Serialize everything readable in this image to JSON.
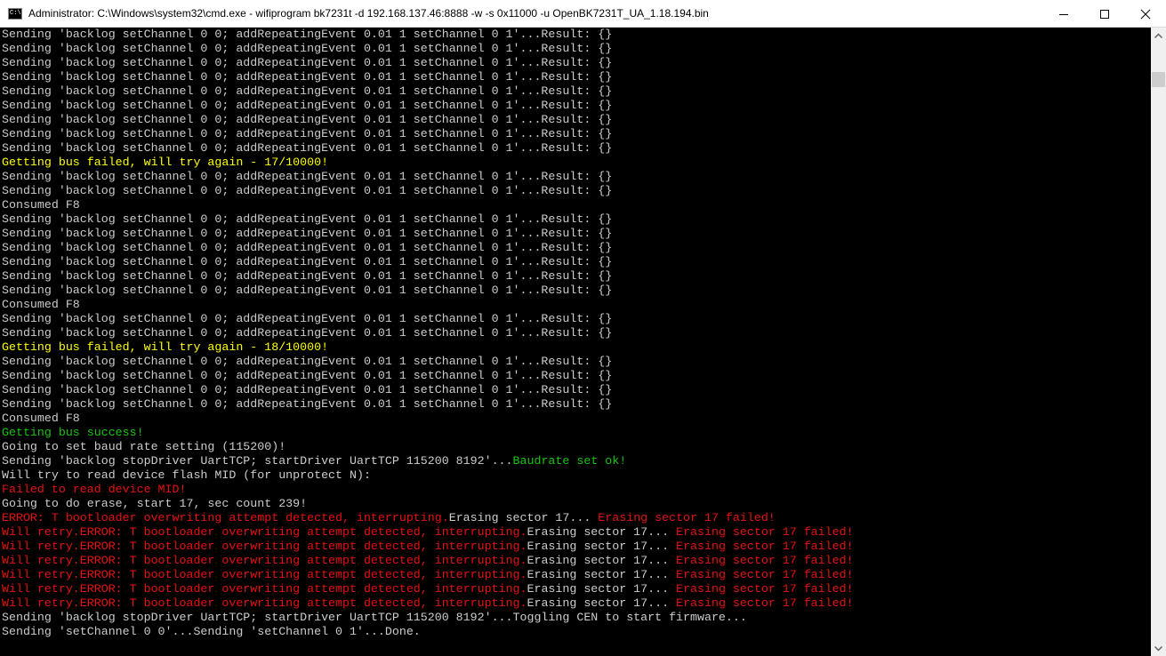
{
  "window": {
    "title": "Administrator: C:\\Windows\\system32\\cmd.exe - wifiprogram  bk7231t -d 192.168.137.46:8888 -w -s 0x11000 -u OpenBK7231T_UA_1.18.194.bin",
    "icon_text": "C:\\"
  },
  "colors": {
    "default": "#cccccc",
    "yellow": "#ffff00",
    "green": "#16c60c",
    "red": "#e81010"
  },
  "lines": [
    {
      "segs": [
        {
          "t": "Sending 'backlog setChannel 0 0; addRepeatingEvent 0.01 1 setChannel 0 1'...Result: {}",
          "c": "default"
        }
      ]
    },
    {
      "segs": [
        {
          "t": "Sending 'backlog setChannel 0 0; addRepeatingEvent 0.01 1 setChannel 0 1'...Result: {}",
          "c": "default"
        }
      ]
    },
    {
      "segs": [
        {
          "t": "Sending 'backlog setChannel 0 0; addRepeatingEvent 0.01 1 setChannel 0 1'...Result: {}",
          "c": "default"
        }
      ]
    },
    {
      "segs": [
        {
          "t": "Sending 'backlog setChannel 0 0; addRepeatingEvent 0.01 1 setChannel 0 1'...Result: {}",
          "c": "default"
        }
      ]
    },
    {
      "segs": [
        {
          "t": "Sending 'backlog setChannel 0 0; addRepeatingEvent 0.01 1 setChannel 0 1'...Result: {}",
          "c": "default"
        }
      ]
    },
    {
      "segs": [
        {
          "t": "Sending 'backlog setChannel 0 0; addRepeatingEvent 0.01 1 setChannel 0 1'...Result: {}",
          "c": "default"
        }
      ]
    },
    {
      "segs": [
        {
          "t": "Sending 'backlog setChannel 0 0; addRepeatingEvent 0.01 1 setChannel 0 1'...Result: {}",
          "c": "default"
        }
      ]
    },
    {
      "segs": [
        {
          "t": "Sending 'backlog setChannel 0 0; addRepeatingEvent 0.01 1 setChannel 0 1'...Result: {}",
          "c": "default"
        }
      ]
    },
    {
      "segs": [
        {
          "t": "Sending 'backlog setChannel 0 0; addRepeatingEvent 0.01 1 setChannel 0 1'...Result: {}",
          "c": "default"
        }
      ]
    },
    {
      "segs": [
        {
          "t": "Getting bus failed, will try again - 17/10000!",
          "c": "yellow"
        }
      ]
    },
    {
      "segs": [
        {
          "t": "Sending 'backlog setChannel 0 0; addRepeatingEvent 0.01 1 setChannel 0 1'...Result: {}",
          "c": "default"
        }
      ]
    },
    {
      "segs": [
        {
          "t": "Sending 'backlog setChannel 0 0; addRepeatingEvent 0.01 1 setChannel 0 1'...Result: {}",
          "c": "default"
        }
      ]
    },
    {
      "segs": [
        {
          "t": "Consumed F8",
          "c": "default"
        }
      ]
    },
    {
      "segs": [
        {
          "t": "Sending 'backlog setChannel 0 0; addRepeatingEvent 0.01 1 setChannel 0 1'...Result: {}",
          "c": "default"
        }
      ]
    },
    {
      "segs": [
        {
          "t": "Sending 'backlog setChannel 0 0; addRepeatingEvent 0.01 1 setChannel 0 1'...Result: {}",
          "c": "default"
        }
      ]
    },
    {
      "segs": [
        {
          "t": "Sending 'backlog setChannel 0 0; addRepeatingEvent 0.01 1 setChannel 0 1'...Result: {}",
          "c": "default"
        }
      ]
    },
    {
      "segs": [
        {
          "t": "Sending 'backlog setChannel 0 0; addRepeatingEvent 0.01 1 setChannel 0 1'...Result: {}",
          "c": "default"
        }
      ]
    },
    {
      "segs": [
        {
          "t": "Sending 'backlog setChannel 0 0; addRepeatingEvent 0.01 1 setChannel 0 1'...Result: {}",
          "c": "default"
        }
      ]
    },
    {
      "segs": [
        {
          "t": "Sending 'backlog setChannel 0 0; addRepeatingEvent 0.01 1 setChannel 0 1'...Result: {}",
          "c": "default"
        }
      ]
    },
    {
      "segs": [
        {
          "t": "Consumed F8",
          "c": "default"
        }
      ]
    },
    {
      "segs": [
        {
          "t": "Sending 'backlog setChannel 0 0; addRepeatingEvent 0.01 1 setChannel 0 1'...Result: {}",
          "c": "default"
        }
      ]
    },
    {
      "segs": [
        {
          "t": "Sending 'backlog setChannel 0 0; addRepeatingEvent 0.01 1 setChannel 0 1'...Result: {}",
          "c": "default"
        }
      ]
    },
    {
      "segs": [
        {
          "t": "Getting bus failed, will try again - 18/10000!",
          "c": "yellow"
        }
      ]
    },
    {
      "segs": [
        {
          "t": "Sending 'backlog setChannel 0 0; addRepeatingEvent 0.01 1 setChannel 0 1'...Result: {}",
          "c": "default"
        }
      ]
    },
    {
      "segs": [
        {
          "t": "Sending 'backlog setChannel 0 0; addRepeatingEvent 0.01 1 setChannel 0 1'...Result: {}",
          "c": "default"
        }
      ]
    },
    {
      "segs": [
        {
          "t": "Sending 'backlog setChannel 0 0; addRepeatingEvent 0.01 1 setChannel 0 1'...Result: {}",
          "c": "default"
        }
      ]
    },
    {
      "segs": [
        {
          "t": "Sending 'backlog setChannel 0 0; addRepeatingEvent 0.01 1 setChannel 0 1'...Result: {}",
          "c": "default"
        }
      ]
    },
    {
      "segs": [
        {
          "t": "Consumed F8",
          "c": "default"
        }
      ]
    },
    {
      "segs": [
        {
          "t": "Getting bus success!",
          "c": "green"
        }
      ]
    },
    {
      "segs": [
        {
          "t": "Going to set baud rate setting (115200)!",
          "c": "default"
        }
      ]
    },
    {
      "segs": [
        {
          "t": "Sending 'backlog stopDriver UartTCP; startDriver UartTCP 115200 8192'...",
          "c": "default"
        },
        {
          "t": "Baudrate set ok!",
          "c": "green"
        }
      ]
    },
    {
      "segs": [
        {
          "t": "Will try to read device flash MID (for unprotect N):",
          "c": "default"
        }
      ]
    },
    {
      "segs": [
        {
          "t": "Failed to read device MID!",
          "c": "red"
        }
      ]
    },
    {
      "segs": [
        {
          "t": "Going to do erase, start 17, sec count 239!",
          "c": "default"
        }
      ]
    },
    {
      "segs": [
        {
          "t": "ERROR: T bootloader overwriting attempt detected, interrupting.",
          "c": "red"
        },
        {
          "t": "Erasing sector 17... ",
          "c": "default"
        },
        {
          "t": "Erasing sector 17 failed!",
          "c": "red"
        }
      ]
    },
    {
      "segs": [
        {
          "t": "Will retry.ERROR: T bootloader overwriting attempt detected, interrupting.",
          "c": "red"
        },
        {
          "t": "Erasing sector 17... ",
          "c": "default"
        },
        {
          "t": "Erasing sector 17 failed!",
          "c": "red"
        }
      ]
    },
    {
      "segs": [
        {
          "t": "Will retry.ERROR: T bootloader overwriting attempt detected, interrupting.",
          "c": "red"
        },
        {
          "t": "Erasing sector 17... ",
          "c": "default"
        },
        {
          "t": "Erasing sector 17 failed!",
          "c": "red"
        }
      ]
    },
    {
      "segs": [
        {
          "t": "Will retry.ERROR: T bootloader overwriting attempt detected, interrupting.",
          "c": "red"
        },
        {
          "t": "Erasing sector 17... ",
          "c": "default"
        },
        {
          "t": "Erasing sector 17 failed!",
          "c": "red"
        }
      ]
    },
    {
      "segs": [
        {
          "t": "Will retry.ERROR: T bootloader overwriting attempt detected, interrupting.",
          "c": "red"
        },
        {
          "t": "Erasing sector 17... ",
          "c": "default"
        },
        {
          "t": "Erasing sector 17 failed!",
          "c": "red"
        }
      ]
    },
    {
      "segs": [
        {
          "t": "Will retry.ERROR: T bootloader overwriting attempt detected, interrupting.",
          "c": "red"
        },
        {
          "t": "Erasing sector 17... ",
          "c": "default"
        },
        {
          "t": "Erasing sector 17 failed!",
          "c": "red"
        }
      ]
    },
    {
      "segs": [
        {
          "t": "Will retry.ERROR: T bootloader overwriting attempt detected, interrupting.",
          "c": "red"
        },
        {
          "t": "Erasing sector 17... ",
          "c": "default"
        },
        {
          "t": "Erasing sector 17 failed!",
          "c": "red"
        }
      ]
    },
    {
      "segs": [
        {
          "t": "Sending 'backlog stopDriver UartTCP; startDriver UartTCP 115200 8192'...Toggling CEN to start firmware...",
          "c": "default"
        }
      ]
    },
    {
      "segs": [
        {
          "t": "Sending 'setChannel 0 0'...Sending 'setChannel 0 1'...Done.",
          "c": "default"
        }
      ]
    }
  ]
}
